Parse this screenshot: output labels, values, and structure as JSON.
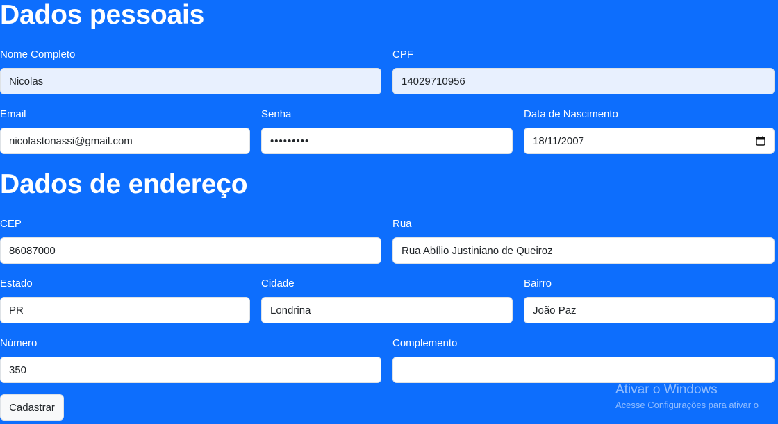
{
  "personal": {
    "title": "Dados pessoais",
    "nome": {
      "label": "Nome Completo",
      "value": "Nicolas"
    },
    "cpf": {
      "label": "CPF",
      "value": "14029710956"
    },
    "email": {
      "label": "Email",
      "value": "nicolastonassi@gmail.com"
    },
    "senha": {
      "label": "Senha",
      "value": "•••••••••"
    },
    "nascimento": {
      "label": "Data de Nascimento",
      "value": "18/11/2007"
    }
  },
  "address": {
    "title": "Dados de endereço",
    "cep": {
      "label": "CEP",
      "value": "86087000"
    },
    "rua": {
      "label": "Rua",
      "value": "Rua Abílio Justiniano de Queiroz"
    },
    "estado": {
      "label": "Estado",
      "value": "PR"
    },
    "cidade": {
      "label": "Cidade",
      "value": "Londrina"
    },
    "bairro": {
      "label": "Bairro",
      "value": "João Paz"
    },
    "numero": {
      "label": "Número",
      "value": "350"
    },
    "complemento": {
      "label": "Complemento",
      "value": ""
    }
  },
  "actions": {
    "submit_label": "Cadastrar"
  },
  "watermark": {
    "title": "Ativar o Windows",
    "subtitle": "Acesse Configurações para ativar o"
  },
  "colors": {
    "background": "#0d6efd",
    "input_background": "#ffffff",
    "autofill_background": "#e8f0fe"
  },
  "icons": {
    "date_picker": "calendar-icon"
  }
}
